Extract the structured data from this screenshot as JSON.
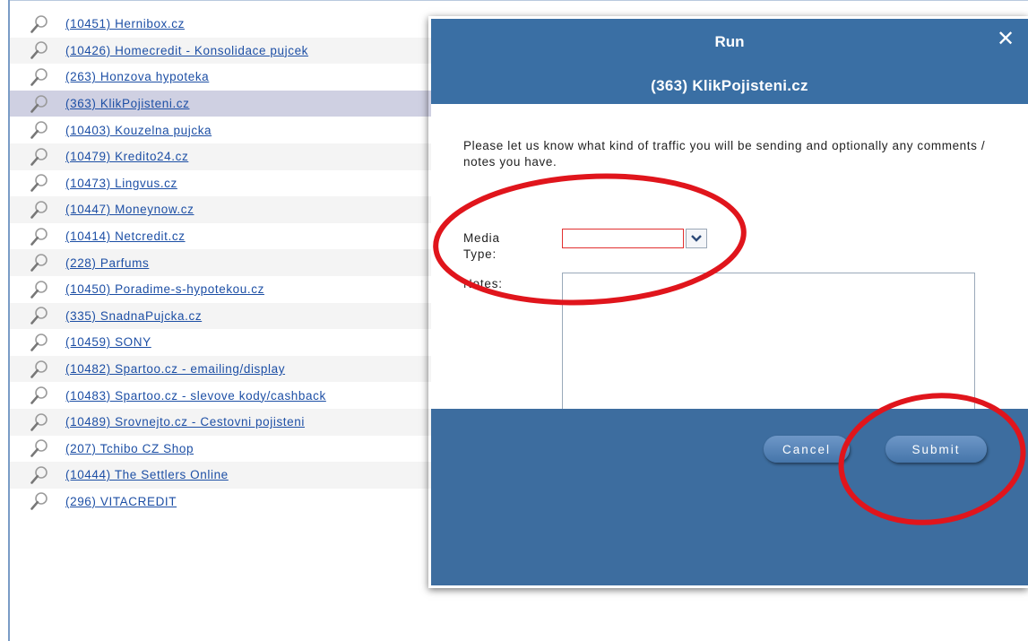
{
  "list": {
    "items": [
      {
        "label": "(10451) Hernibox.cz"
      },
      {
        "label": "(10426) Homecredit - Konsolidace pujcek"
      },
      {
        "label": "(263) Honzova hypoteka"
      },
      {
        "label": "(363) KlikPojisteni.cz",
        "selected": true
      },
      {
        "label": "(10403) Kouzelna pujcka"
      },
      {
        "label": "(10479) Kredito24.cz"
      },
      {
        "label": "(10473) Lingvus.cz"
      },
      {
        "label": "(10447) Moneynow.cz"
      },
      {
        "label": "(10414) Netcredit.cz"
      },
      {
        "label": "(228) Parfums"
      },
      {
        "label": "(10450) Poradime-s-hypotekou.cz"
      },
      {
        "label": "(335) SnadnaPujcka.cz"
      },
      {
        "label": "(10459) SONY"
      },
      {
        "label": "(10482) Spartoo.cz - emailing/display"
      },
      {
        "label": "(10483) Spartoo.cz - slevove kody/cashback"
      },
      {
        "label": "(10489) Srovnejto.cz - Cestovni pojisteni"
      },
      {
        "label": "(207) Tchibo CZ Shop"
      },
      {
        "label": "(10444) The Settlers Online"
      },
      {
        "label": "(296) VITACREDIT"
      }
    ],
    "row_icon": "magnifier-icon"
  },
  "dialog": {
    "title": "Run",
    "subtitle": "(363) KlikPojisteni.cz",
    "close_icon": "close-icon",
    "instructions": "Please let us know what kind of traffic you will be sending and optionally any comments / notes you have.",
    "media_type_label": "Media Type:",
    "media_type_value": "",
    "notes_label": "Notes:",
    "notes_value": "",
    "cancel_label": "Cancel",
    "submit_label": "Submit"
  },
  "colors": {
    "header_blue": "#3a6fa4",
    "link_blue": "#1d4fa5",
    "selected_row": "#cfd0e2",
    "annotation_red": "#e0151c"
  }
}
